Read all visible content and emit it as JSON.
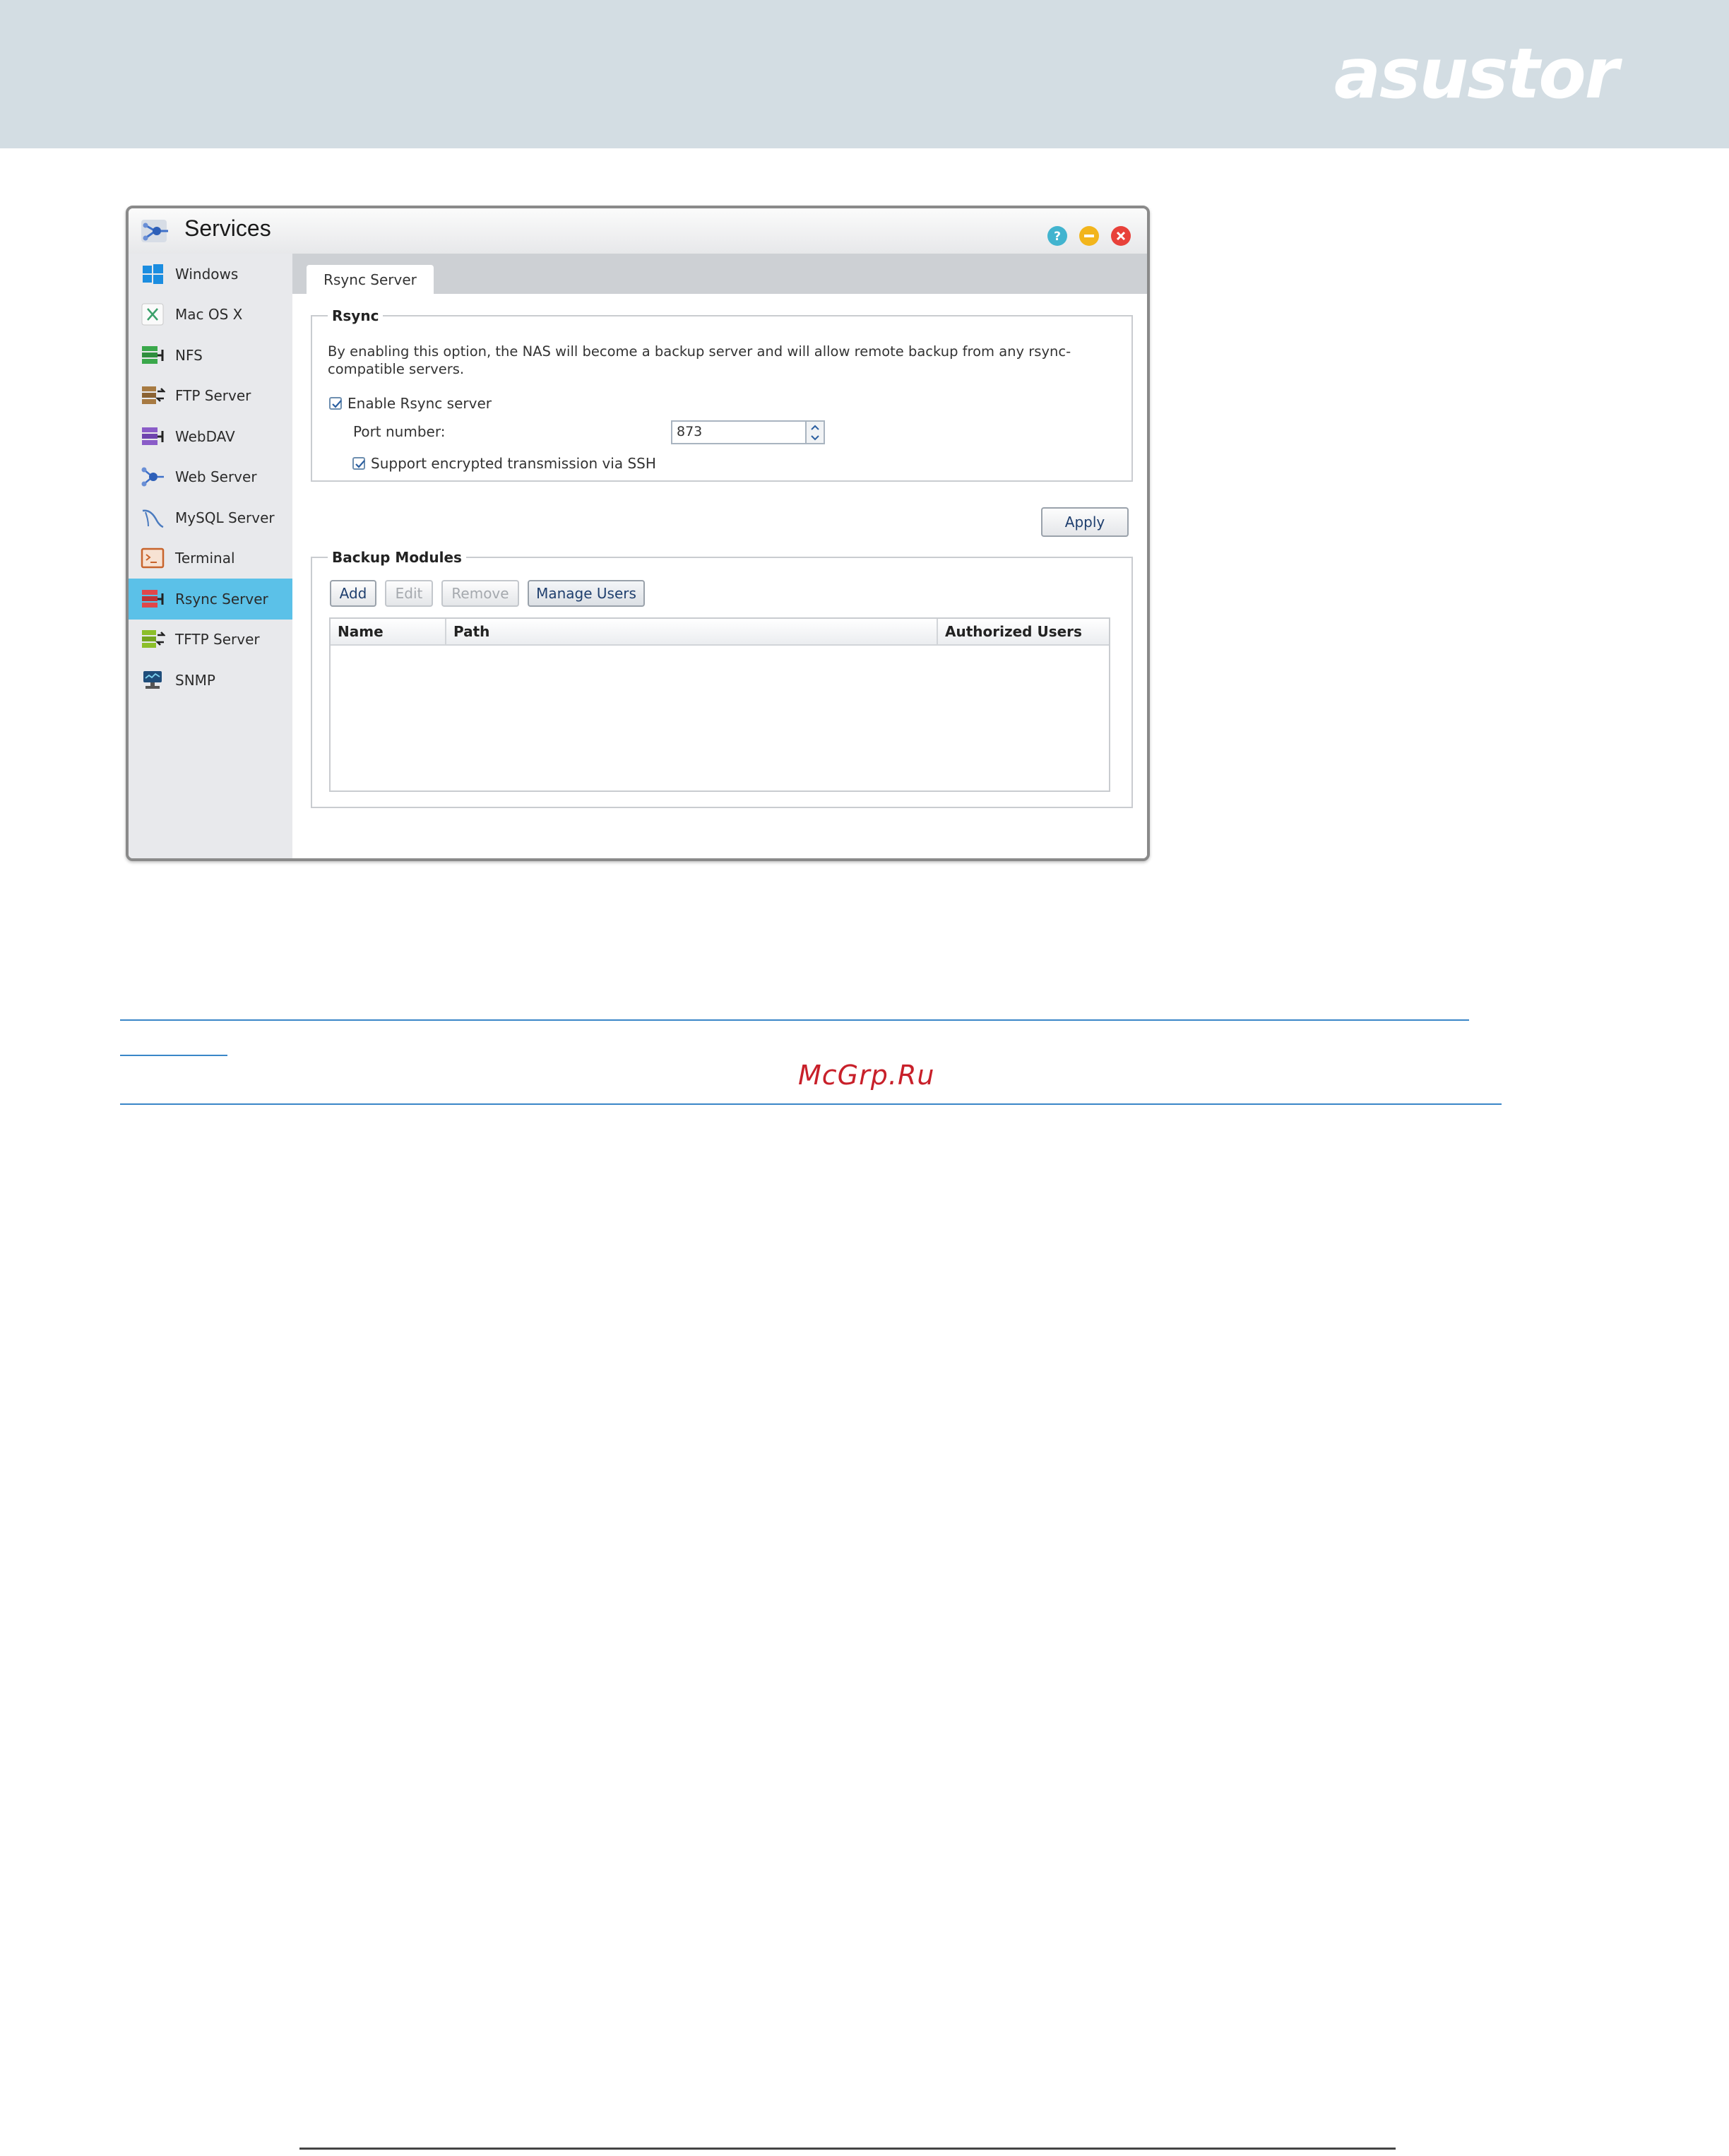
{
  "brand": {
    "logo_text": "asustor"
  },
  "window": {
    "title": "Services",
    "icon": "services-icon",
    "controls": [
      "help-icon",
      "minimize-icon",
      "close-icon"
    ]
  },
  "sidebar": {
    "items": [
      {
        "label": "Windows",
        "icon": "windows-icon",
        "active": false
      },
      {
        "label": "Mac OS X",
        "icon": "mac-os-x-icon",
        "active": false
      },
      {
        "label": "NFS",
        "icon": "nfs-icon",
        "active": false
      },
      {
        "label": "FTP Server",
        "icon": "ftp-server-icon",
        "active": false
      },
      {
        "label": "WebDAV",
        "icon": "webdav-icon",
        "active": false
      },
      {
        "label": "Web Server",
        "icon": "web-server-icon",
        "active": false
      },
      {
        "label": "MySQL Server",
        "icon": "mysql-server-icon",
        "active": false
      },
      {
        "label": "Terminal",
        "icon": "terminal-icon",
        "active": false
      },
      {
        "label": "Rsync Server",
        "icon": "rsync-server-icon",
        "active": true
      },
      {
        "label": "TFTP Server",
        "icon": "tftp-server-icon",
        "active": false
      },
      {
        "label": "SNMP",
        "icon": "snmp-icon",
        "active": false
      }
    ]
  },
  "tabs": [
    {
      "label": "Rsync Server",
      "active": true
    }
  ],
  "rsync": {
    "legend": "Rsync",
    "description": "By enabling this option, the NAS will become a backup server and will allow remote backup from any rsync-compatible servers.",
    "enable_label": "Enable Rsync server",
    "enable_checked": true,
    "port_label": "Port number:",
    "port_value": "873",
    "ssh_label": "Support encrypted transmission via SSH",
    "ssh_checked": true
  },
  "apply_label": "Apply",
  "backup_modules": {
    "legend": "Backup Modules",
    "buttons": {
      "add": "Add",
      "edit": "Edit",
      "remove": "Remove",
      "manage_users": "Manage Users"
    },
    "columns": [
      "Name",
      "Path",
      "Authorized Users"
    ],
    "rows": []
  },
  "watermark": "McGrp.Ru",
  "colors": {
    "header_band": "#d3dde3",
    "sidebar_active": "#5bc1e8",
    "link_rule": "#3a86c8",
    "watermark": "#c8202a"
  }
}
